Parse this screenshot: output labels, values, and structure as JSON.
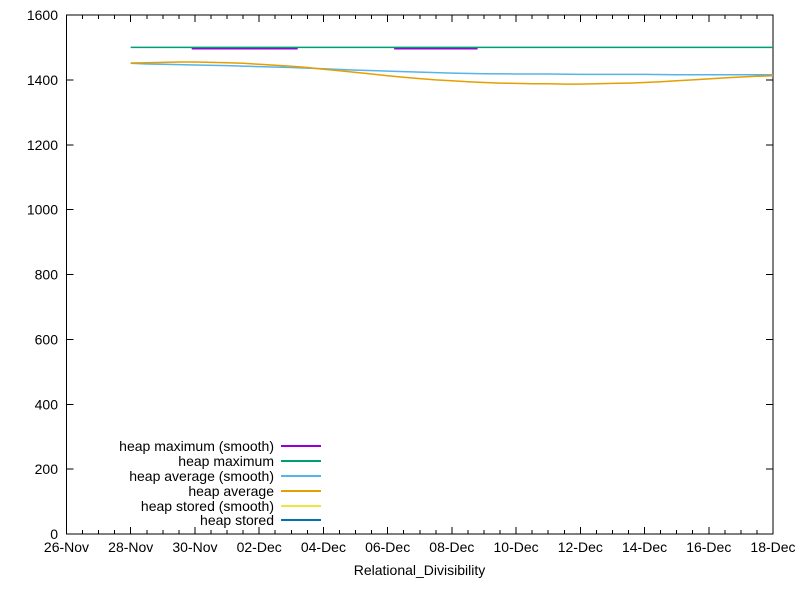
{
  "window": {
    "background": "#ffffff",
    "axis_color": "#000000",
    "text_color": "#000000"
  },
  "chart_data": {
    "type": "line",
    "title": "",
    "xlabel": "Relational_Divisibility",
    "ylabel": "",
    "grid": false,
    "x_axis": {
      "unit": "days offset from 26-Nov",
      "range_days": [
        0,
        22
      ],
      "tick_days": [
        0,
        2,
        4,
        6,
        8,
        10,
        12,
        14,
        16,
        18,
        20,
        22
      ],
      "tick_labels": [
        "26-Nov",
        "28-Nov",
        "30-Nov",
        "02-Dec",
        "04-Dec",
        "06-Dec",
        "08-Dec",
        "10-Dec",
        "12-Dec",
        "14-Dec",
        "16-Dec",
        "18-Dec"
      ],
      "minor_tick_step_days": 0.5
    },
    "y_axis": {
      "range": [
        0,
        1600
      ],
      "tick_step": 200,
      "ticks": [
        0,
        200,
        400,
        600,
        800,
        1000,
        1200,
        1400,
        1600
      ]
    },
    "legend": {
      "position": "inside bottom-left",
      "entries": [
        {
          "label": "heap maximum (smooth)",
          "color": "#9400d3"
        },
        {
          "label": "heap maximum",
          "color": "#009e73"
        },
        {
          "label": "heap average (smooth)",
          "color": "#56b4e9"
        },
        {
          "label": "heap average",
          "color": "#e69f00"
        },
        {
          "label": "heap stored (smooth)",
          "color": "#f0e442"
        },
        {
          "label": "heap stored",
          "color": "#0072b2"
        }
      ]
    },
    "series": [
      {
        "name": "heap maximum (smooth)",
        "color": "#9400d3",
        "note": "visible only where it dips just below the heap maximum line",
        "segments": [
          [
            [
              3.9,
              1496
            ],
            [
              7.2,
              1496
            ]
          ],
          [
            [
              10.2,
              1496
            ],
            [
              12.8,
              1496
            ]
          ]
        ]
      },
      {
        "name": "heap maximum",
        "color": "#009e73",
        "segments": [
          [
            [
              2,
              1500
            ],
            [
              22,
              1500
            ]
          ]
        ]
      },
      {
        "name": "heap average (smooth)",
        "color": "#56b4e9",
        "segments": [
          [
            [
              2,
              1451
            ],
            [
              2.5,
              1449
            ],
            [
              3,
              1448
            ],
            [
              3.5,
              1447
            ],
            [
              4,
              1446
            ],
            [
              5,
              1444
            ],
            [
              6,
              1441
            ],
            [
              7,
              1438
            ],
            [
              8,
              1434
            ],
            [
              9,
              1430
            ],
            [
              10,
              1427
            ],
            [
              11,
              1424
            ],
            [
              12,
              1421
            ],
            [
              13,
              1419
            ],
            [
              14,
              1418
            ],
            [
              15,
              1418
            ],
            [
              16,
              1417
            ],
            [
              17,
              1417
            ],
            [
              18,
              1417
            ],
            [
              19,
              1416
            ],
            [
              20,
              1416
            ],
            [
              21,
              1416
            ],
            [
              22,
              1416
            ]
          ]
        ]
      },
      {
        "name": "heap average",
        "color": "#e69f00",
        "segments": [
          [
            [
              2,
              1452
            ],
            [
              2.5,
              1453
            ],
            [
              3,
              1454
            ],
            [
              3.5,
              1455
            ],
            [
              4,
              1455
            ],
            [
              4.5,
              1454
            ],
            [
              5,
              1453
            ],
            [
              5.5,
              1451
            ],
            [
              6,
              1448
            ],
            [
              6.5,
              1445
            ],
            [
              7,
              1442
            ],
            [
              7.5,
              1438
            ],
            [
              8,
              1433
            ],
            [
              8.5,
              1428
            ],
            [
              9,
              1423
            ],
            [
              9.5,
              1418
            ],
            [
              10,
              1413
            ],
            [
              10.5,
              1408
            ],
            [
              11,
              1404
            ],
            [
              11.5,
              1400
            ],
            [
              12,
              1397
            ],
            [
              12.5,
              1394
            ],
            [
              13,
              1392
            ],
            [
              13.5,
              1390
            ],
            [
              14,
              1389
            ],
            [
              14.5,
              1388
            ],
            [
              15,
              1388
            ],
            [
              15.5,
              1387
            ],
            [
              16,
              1387
            ],
            [
              16.5,
              1388
            ],
            [
              17,
              1389
            ],
            [
              17.5,
              1390
            ],
            [
              18,
              1392
            ],
            [
              18.5,
              1394
            ],
            [
              19,
              1397
            ],
            [
              19.5,
              1400
            ],
            [
              20,
              1403
            ],
            [
              20.5,
              1406
            ],
            [
              21,
              1409
            ],
            [
              21.5,
              1411
            ],
            [
              22,
              1413
            ]
          ]
        ]
      },
      {
        "name": "heap stored (smooth)",
        "color": "#f0e442",
        "note": "not separately visible in the plot (hidden behind other lines)",
        "segments": []
      },
      {
        "name": "heap stored",
        "color": "#0072b2",
        "note": "not separately visible in the plot (hidden behind other lines)",
        "segments": []
      }
    ]
  }
}
